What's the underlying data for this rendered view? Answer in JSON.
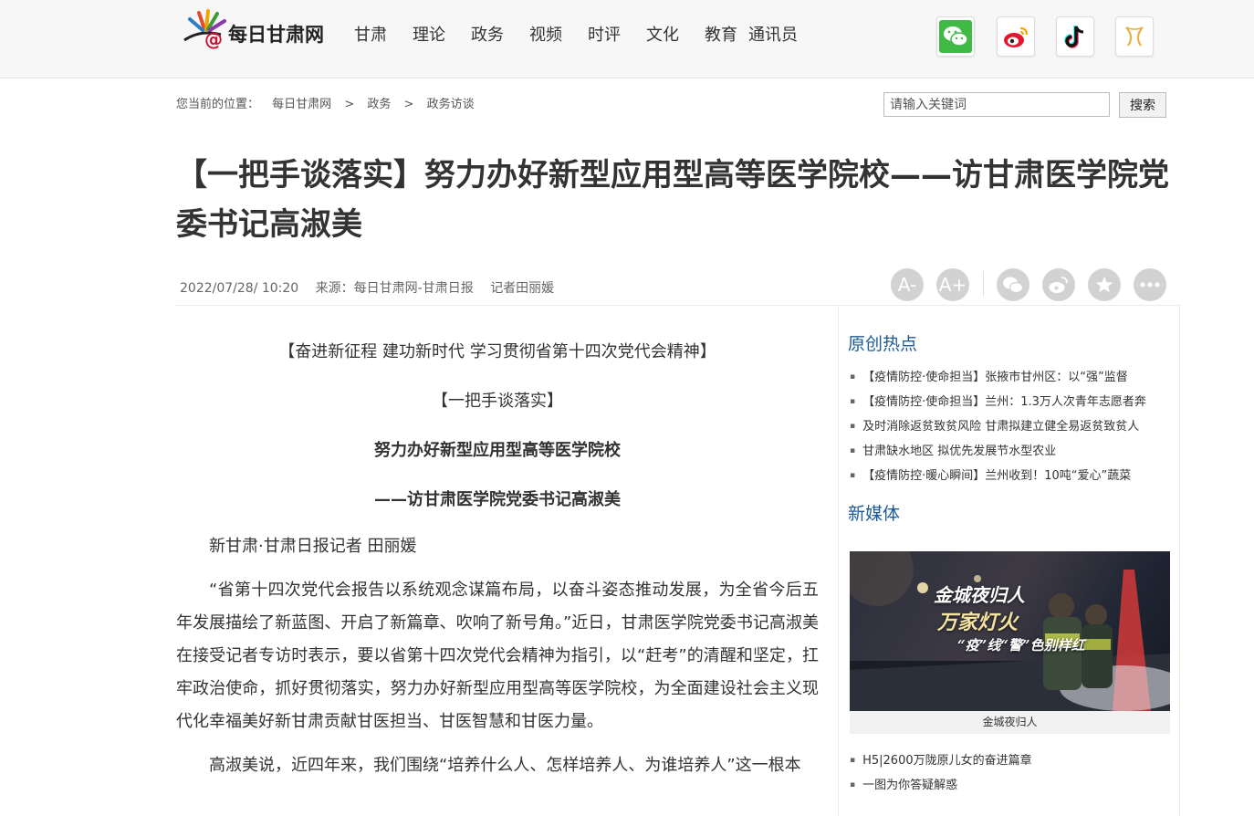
{
  "header": {
    "site_name": "每日甘肃网",
    "nav": [
      "甘肃",
      "理论",
      "政务",
      "视频",
      "时评",
      "文化",
      "教育",
      "通讯员"
    ],
    "social_icons": [
      "wechat-icon",
      "weibo-icon",
      "douyin-icon",
      "app-icon"
    ]
  },
  "breadcrumb": {
    "prefix": "您当前的位置：",
    "items": [
      "每日甘肃网",
      "政务",
      "政务访谈"
    ],
    "separator": ">"
  },
  "search": {
    "placeholder": "请输入关键词",
    "button_label": "搜索"
  },
  "article": {
    "title": "【一把手谈落实】努力办好新型应用型高等医学院校——访甘肃医学院党委书记高淑美",
    "datetime": "2022/07/28/ 10:20",
    "source": "来源：每日甘肃网-甘肃日报",
    "reporter": "记者田丽媛",
    "tools": {
      "font_decrease": "A-",
      "font_increase": "A+"
    },
    "lead_1": "【奋进新征程 建功新时代 学习贯彻省第十四次党代会精神】",
    "lead_2": "【一把手谈落实】",
    "subtitle_1": "努力办好新型应用型高等医学院校",
    "subtitle_2": "——访甘肃医学院党委书记高淑美",
    "byline": "新甘肃·甘肃日报记者 田丽媛",
    "paragraph_1": "“省第十四次党代会报告以系统观念谋篇布局，以奋斗姿态推动发展，为全省今后五年发展描绘了新蓝图、开启了新篇章、吹响了新号角。”近日，甘肃医学院党委书记高淑美在接受记者专访时表示，要以省第十四次党代会精神为指引，以“赶考”的清醒和坚定，扛牢政治使命，抓好贯彻落实，努力办好新型应用型高等医学院校，为全面建设社会主义现代化幸福美好新甘肃贡献甘医担当、甘医智慧和甘医力量。",
    "paragraph_2": "高淑美说，近四年来，我们围绕“培养什么人、怎样培养人、为谁培养人”这一根本"
  },
  "sidebar": {
    "hot_title": "原创热点",
    "hot_items": [
      "【疫情防控·使命担当】张掖市甘州区：以“强”监督",
      "【疫情防控·使命担当】兰州：1.3万人次青年志愿者奔",
      "及时消除返贫致贫风险 甘肃拟建立健全易返贫致贫人",
      "甘肃缺水地区 拟优先发展节水型农业",
      "【疫情防控·暖心瞬间】兰州收到！10吨“爱心”蔬菜"
    ],
    "media_title": "新媒体",
    "media_poster_lines": [
      "金城夜归人",
      "万家灯火",
      "“疫”线“警”色别样红"
    ],
    "media_caption": "金城夜归人",
    "media_items": [
      "H5|2600万陇原儿女的奋进篇章",
      "一图为你答疑解惑"
    ]
  },
  "colors": {
    "accent_blue": "#1b5a9a",
    "wechat_green": "#3fbb45",
    "weibo_red": "#e6162d"
  }
}
